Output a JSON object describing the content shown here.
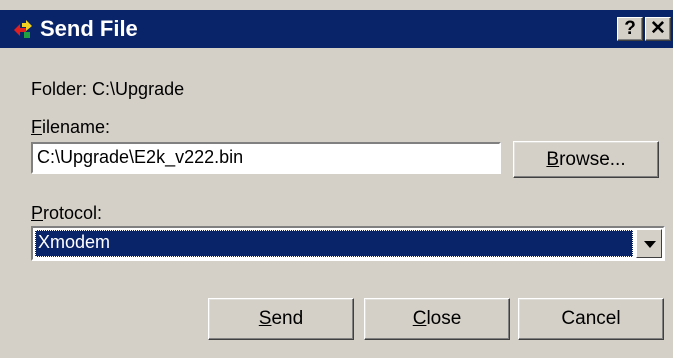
{
  "window": {
    "title": "Send File",
    "help_glyph": "?",
    "close_glyph": "✕"
  },
  "folder": {
    "label": "Folder:",
    "value": "C:\\Upgrade"
  },
  "filename": {
    "label_accel": "F",
    "label_rest": "ilename:",
    "value": "C:\\Upgrade\\E2k_v222.bin",
    "browse_accel": "B",
    "browse_rest": "rowse..."
  },
  "protocol": {
    "label_accel": "P",
    "label_rest": "rotocol:",
    "selected": "Xmodem"
  },
  "buttons": {
    "send_accel": "S",
    "send_rest": "end",
    "close_accel": "C",
    "close_rest": "lose",
    "cancel": "Cancel"
  },
  "colors": {
    "titlebar": "#0a246a",
    "face": "#d4d0c8",
    "selection": "#0a246a"
  }
}
